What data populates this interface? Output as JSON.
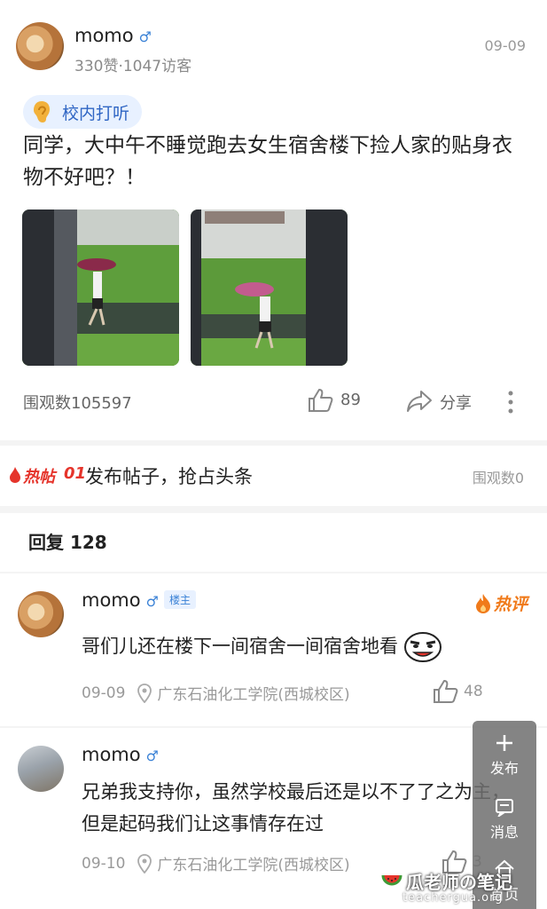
{
  "post": {
    "username": "momo",
    "gender_symbol": "♂",
    "stats": "330赞·1047访客",
    "date": "09-09",
    "tag": "校内打听",
    "title": "同学，大中午不睡觉跑去女生宿舍楼下捡人家的贴身衣物不好吧？！",
    "views": "围观数105597",
    "likes": "89",
    "share_label": "分享"
  },
  "hot": {
    "badge": "热帖",
    "rank": "01",
    "text": "发布帖子，抢占头条",
    "views": "围观数0"
  },
  "replies": {
    "heading": "回复 128"
  },
  "comments": [
    {
      "username": "momo",
      "gender_symbol": "♂",
      "owner_badge": "楼主",
      "hot_label": "热评",
      "text": "哥们儿还在楼下一间宿舍一间宿舍地看",
      "date": "09-09",
      "location": "广东石油化工学院(西城校区)",
      "likes": "48"
    },
    {
      "username": "momo",
      "gender_symbol": "♂",
      "text": "兄弟我支持你，虽然学校最后还是以不了了之为主，但是起码我们让这事情存在过",
      "date": "09-10",
      "location": "广东石油化工学院(西城校区)",
      "likes": "3"
    }
  ],
  "float_menu": {
    "publish_label": "发布",
    "messages_label": "消息",
    "home_label": "首页"
  },
  "watermark": {
    "title": "瓜老师の笔记",
    "url": "teachergua.org"
  }
}
